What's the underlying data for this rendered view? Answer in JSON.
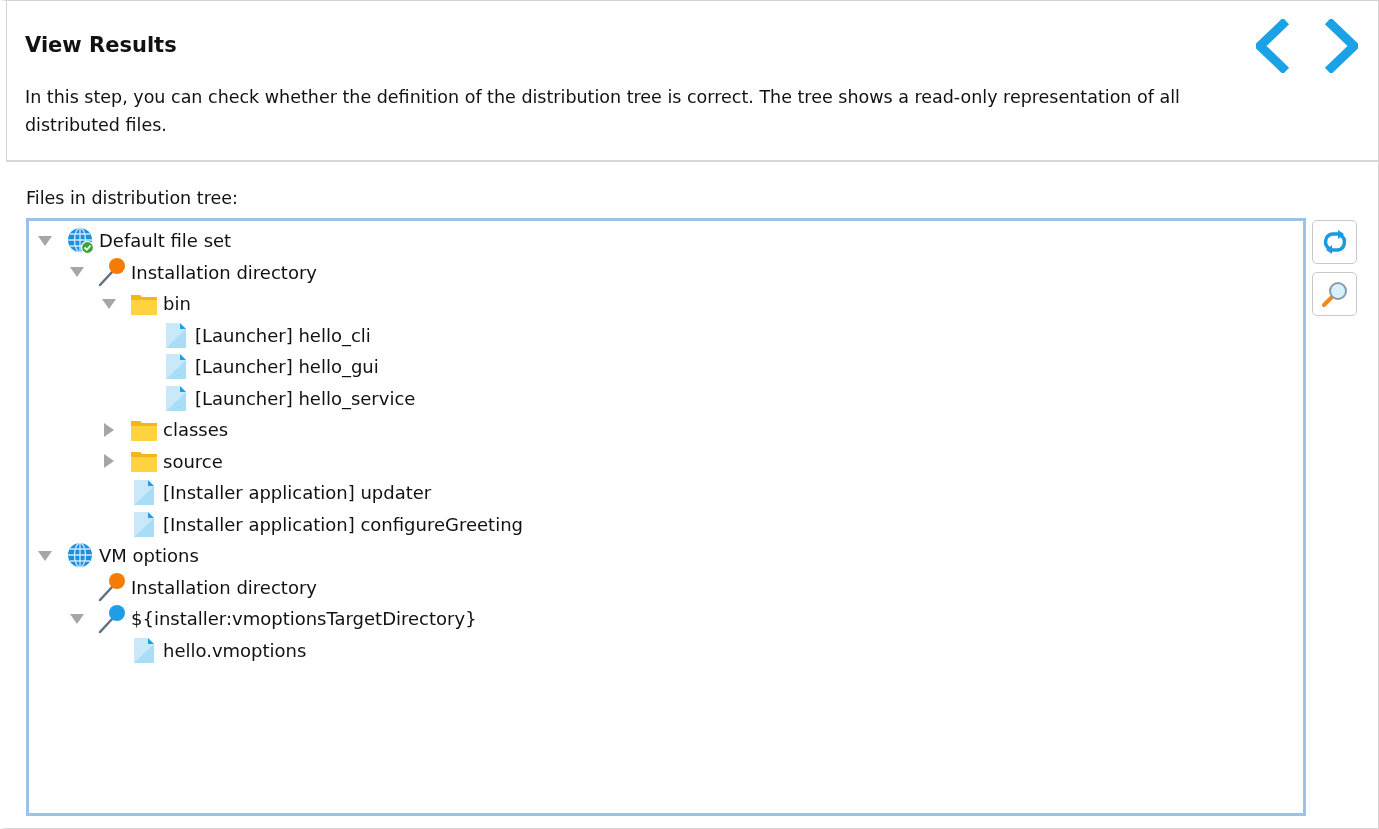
{
  "header": {
    "title": "View Results",
    "description": "In this step, you can check whether the definition of the distribution tree is correct. The tree shows a read-only representation of all distributed files."
  },
  "tree_label": "Files in distribution tree:",
  "tree": [
    {
      "kind": "fileset",
      "label": "Default file set",
      "checked": true,
      "expanded": true,
      "children": [
        {
          "kind": "directory",
          "label": "Installation directory",
          "color": "#f57c00",
          "expanded": true,
          "children": [
            {
              "kind": "folder",
              "label": "bin",
              "expanded": true,
              "children": [
                {
                  "kind": "file",
                  "label": "[Launcher] hello_cli"
                },
                {
                  "kind": "file",
                  "label": "[Launcher] hello_gui"
                },
                {
                  "kind": "file",
                  "label": "[Launcher] hello_service"
                }
              ]
            },
            {
              "kind": "folder",
              "label": "classes",
              "expanded": false
            },
            {
              "kind": "folder",
              "label": "source",
              "expanded": false
            },
            {
              "kind": "file",
              "label": "[Installer application] updater"
            },
            {
              "kind": "file",
              "label": "[Installer application] configureGreeting"
            }
          ]
        }
      ]
    },
    {
      "kind": "fileset",
      "label": "VM options",
      "checked": false,
      "expanded": true,
      "children": [
        {
          "kind": "directory",
          "label": "Installation directory",
          "color": "#f57c00"
        },
        {
          "kind": "directory",
          "label": "${installer:vmoptionsTargetDirectory}",
          "color": "#1e9ee8",
          "expanded": true,
          "children": [
            {
              "kind": "file",
              "label": "hello.vmoptions"
            }
          ]
        }
      ]
    }
  ]
}
